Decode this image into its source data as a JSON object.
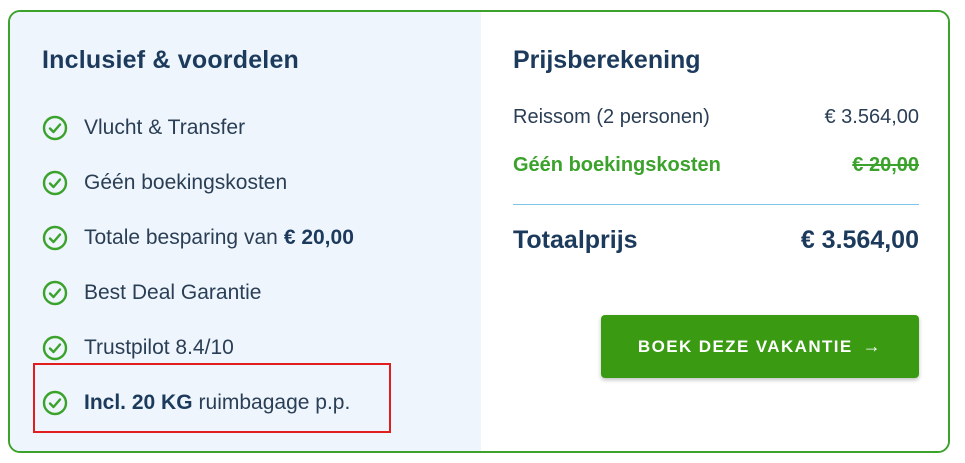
{
  "colors": {
    "accent_green": "#3ba22c",
    "button_green": "#3a9b12",
    "heading_navy": "#1c3a5c",
    "left_panel_bg": "#eef5fc",
    "highlight_red": "#e11d1d"
  },
  "inclusions": {
    "title": "Inclusief & voordelen",
    "items": [
      {
        "icon": "check-circle-icon",
        "text": "Vlucht & Transfer"
      },
      {
        "icon": "check-circle-icon",
        "text": "Géén boekingskosten"
      },
      {
        "icon": "check-circle-icon",
        "text": "Totale besparing van",
        "strong": "€ 20,00"
      },
      {
        "icon": "check-circle-icon",
        "text": "Best Deal Garantie"
      },
      {
        "icon": "check-circle-icon",
        "text": "Trustpilot 8.4/10"
      },
      {
        "icon": "check-circle-icon",
        "strong": "Incl. 20 KG",
        "text": "ruimbagage p.p.",
        "highlighted": true
      }
    ]
  },
  "pricing": {
    "title": "Prijsberekening",
    "travel_sum_label": "Reissom (2 personen)",
    "travel_sum_value": "€ 3.564,00",
    "fee_label": "Géén boekingskosten",
    "fee_value": "€ 20,00",
    "total_label": "Totaalprijs",
    "total_value": "€ 3.564,00",
    "book_button_label": "BOEK DEZE VAKANTIE",
    "book_button_arrow": "→"
  }
}
